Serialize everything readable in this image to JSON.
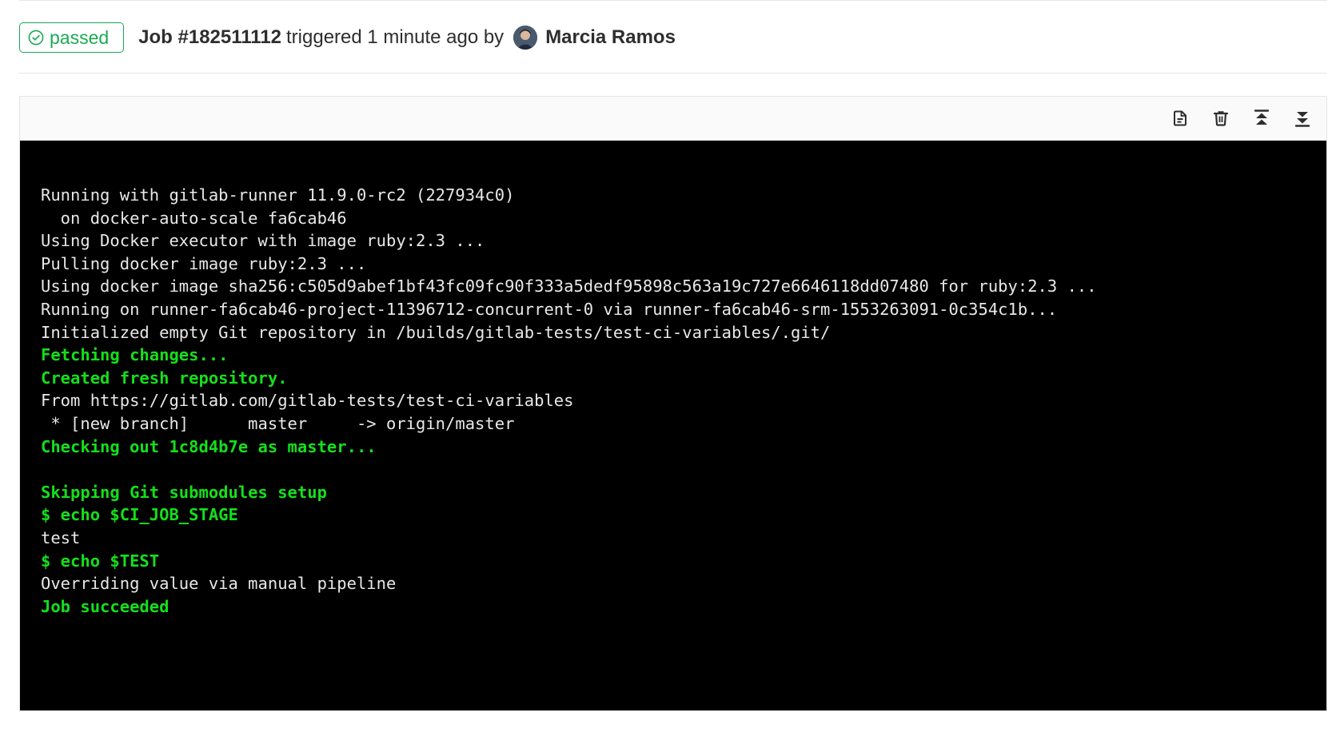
{
  "job": {
    "status": "passed",
    "title": "Job #182511112",
    "trigger_text": "triggered 1 minute ago by",
    "user": "Marcia Ramos"
  },
  "toolbar": {
    "raw_icon": "raw-log-icon",
    "erase_icon": "erase-trash-icon",
    "scroll_top_icon": "scroll-top-icon",
    "scroll_bottom_icon": "scroll-bottom-icon"
  },
  "colors": {
    "success": "#1aaa55",
    "log_bg": "#000000",
    "log_text": "#e8e8e8",
    "log_green": "#14e01a"
  },
  "log": {
    "lines": [
      {
        "text": "Running with gitlab-runner 11.9.0-rc2 (227934c0)",
        "style": "normal"
      },
      {
        "text": "  on docker-auto-scale fa6cab46",
        "style": "normal"
      },
      {
        "text": "Using Docker executor with image ruby:2.3 ...",
        "style": "normal"
      },
      {
        "text": "Pulling docker image ruby:2.3 ...",
        "style": "normal"
      },
      {
        "text": "Using docker image sha256:c505d9abef1bf43fc09fc90f333a5dedf95898c563a19c727e6646118dd07480 for ruby:2.3 ...",
        "style": "normal"
      },
      {
        "text": "Running on runner-fa6cab46-project-11396712-concurrent-0 via runner-fa6cab46-srm-1553263091-0c354c1b...",
        "style": "normal"
      },
      {
        "text": "Initialized empty Git repository in /builds/gitlab-tests/test-ci-variables/.git/",
        "style": "normal"
      },
      {
        "text": "Fetching changes...",
        "style": "green"
      },
      {
        "text": "Created fresh repository.",
        "style": "green"
      },
      {
        "text": "From https://gitlab.com/gitlab-tests/test-ci-variables",
        "style": "normal"
      },
      {
        "text": " * [new branch]      master     -> origin/master",
        "style": "normal"
      },
      {
        "text": "Checking out 1c8d4b7e as master...",
        "style": "green"
      },
      {
        "text": "",
        "style": "normal"
      },
      {
        "text": "Skipping Git submodules setup",
        "style": "green"
      },
      {
        "text": "$ echo $CI_JOB_STAGE",
        "style": "green"
      },
      {
        "text": "test",
        "style": "normal"
      },
      {
        "text": "$ echo $TEST",
        "style": "green"
      },
      {
        "text": "Overriding value via manual pipeline",
        "style": "normal"
      },
      {
        "text": "Job succeeded",
        "style": "green"
      }
    ]
  }
}
